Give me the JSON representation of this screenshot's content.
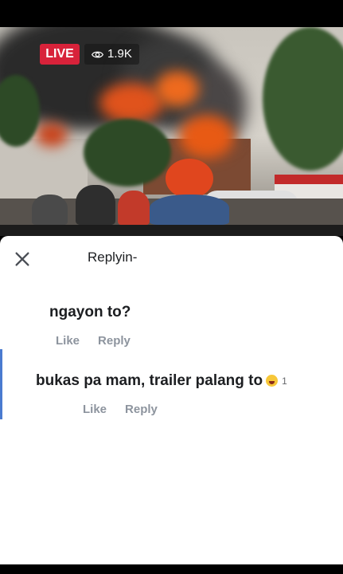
{
  "live_video": {
    "live_label": "LIVE",
    "viewer_count": "1.9K"
  },
  "reply_sheet": {
    "title": "Replyin-",
    "comments": [
      {
        "text": "ngayon to?",
        "like_label": "Like",
        "reply_label": "Reply"
      },
      {
        "text": "bukas pa mam, trailer palang to",
        "reaction_count": "1",
        "like_label": "Like",
        "reply_label": "Reply"
      }
    ]
  },
  "icons": {
    "viewers": "eye-icon",
    "close": "close-icon",
    "reaction": "laughing-emoji-icon"
  },
  "colors": {
    "live": "#d8223a",
    "highlight": "#4a7bd0",
    "action_text": "#8d949e"
  }
}
